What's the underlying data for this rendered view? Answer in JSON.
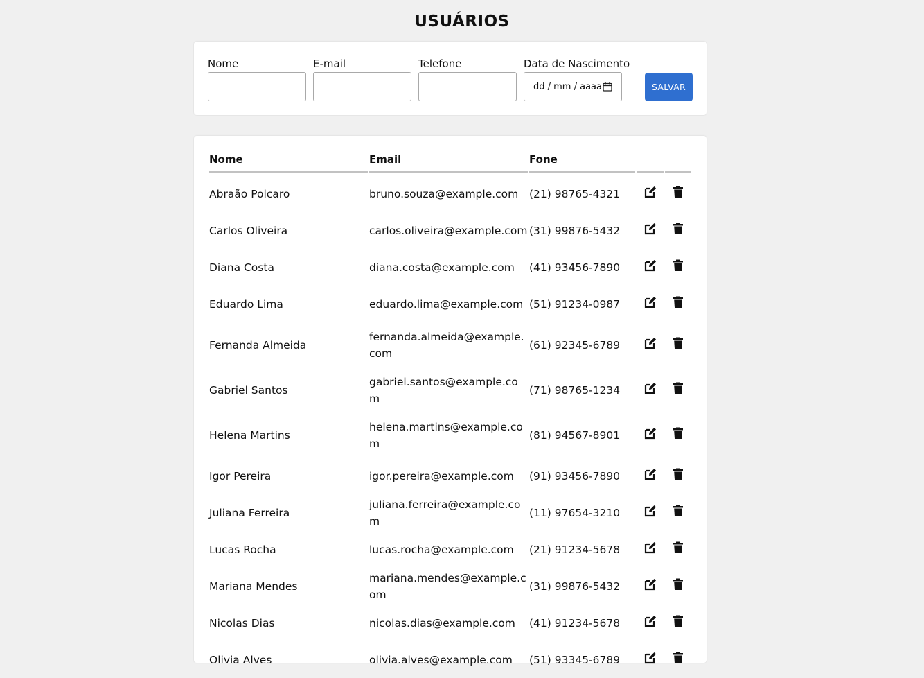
{
  "page_title": "USUÁRIOS",
  "form": {
    "fields": [
      {
        "label": "Nome",
        "value": "",
        "placeholder": ""
      },
      {
        "label": "E-mail",
        "value": "",
        "placeholder": ""
      },
      {
        "label": "Telefone",
        "value": "",
        "placeholder": ""
      }
    ],
    "birth_date": {
      "label": "Data de Nascimento",
      "placeholder": "dd / mm / aaaa"
    },
    "save_label": "SALVAR"
  },
  "table": {
    "headers": {
      "name": "Nome",
      "email": "Email",
      "phone": "Fone",
      "edit": "",
      "delete": ""
    },
    "rows": [
      {
        "name": "Abraão Polcaro",
        "email": "bruno.souza@example.com",
        "phone": "(21) 98765-4321"
      },
      {
        "name": "Carlos Oliveira",
        "email": "carlos.oliveira@example.com",
        "phone": "(31) 99876-5432"
      },
      {
        "name": "Diana Costa",
        "email": "diana.costa@example.com",
        "phone": "(41) 93456-7890"
      },
      {
        "name": "Eduardo Lima",
        "email": "eduardo.lima@example.com",
        "phone": "(51) 91234-0987"
      },
      {
        "name": "Fernanda Almeida",
        "email": "fernanda.almeida@example.com",
        "phone": "(61) 92345-6789"
      },
      {
        "name": "Gabriel Santos",
        "email": "gabriel.santos@example.com",
        "phone": "(71) 98765-1234"
      },
      {
        "name": "Helena Martins",
        "email": "helena.martins@example.com",
        "phone": "(81) 94567-8901"
      },
      {
        "name": "Igor Pereira",
        "email": "igor.pereira@example.com",
        "phone": "(91) 93456-7890"
      },
      {
        "name": "Juliana Ferreira",
        "email": "juliana.ferreira@example.com",
        "phone": "(11) 97654-3210"
      },
      {
        "name": "Lucas Rocha",
        "email": "lucas.rocha@example.com",
        "phone": "(21) 91234-5678"
      },
      {
        "name": "Mariana Mendes",
        "email": "mariana.mendes@example.com",
        "phone": "(31) 99876-5432"
      },
      {
        "name": "Nicolas Dias",
        "email": "nicolas.dias@example.com",
        "phone": "(41) 91234-5678"
      },
      {
        "name": "Olivia Alves",
        "email": "olivia.alves@example.com",
        "phone": "(51) 93345-6789"
      }
    ]
  },
  "icons": {
    "edit": "edit-icon",
    "delete": "trash-icon",
    "date": "calendar-icon"
  },
  "colors": {
    "accent": "#2f6fd0",
    "background": "#f0f0f0",
    "header_rule": "#c2c2c2"
  }
}
